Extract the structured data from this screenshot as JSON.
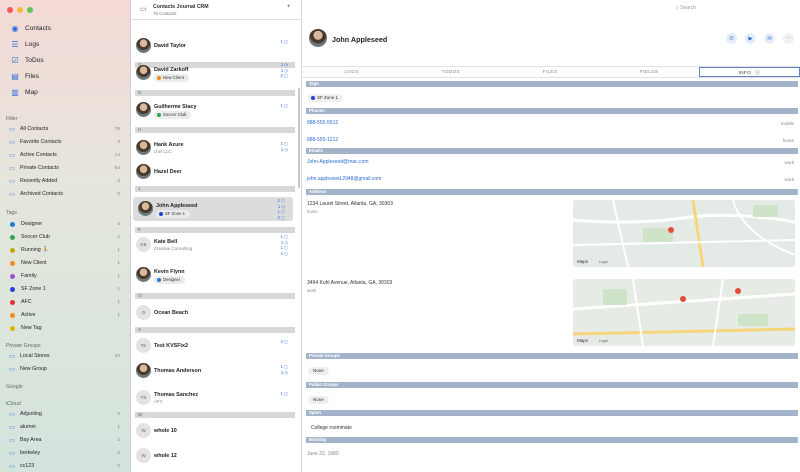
{
  "sidebar": {
    "nav": [
      {
        "label": "Contacts",
        "icon": "person-circle-icon"
      },
      {
        "label": "Logs",
        "icon": "list-icon"
      },
      {
        "label": "ToDos",
        "icon": "checklist-icon"
      },
      {
        "label": "Files",
        "icon": "document-icon"
      },
      {
        "label": "Map",
        "icon": "map-icon"
      }
    ],
    "filter_title": "Filter",
    "filters": [
      {
        "label": "All Contacts",
        "count": "76"
      },
      {
        "label": "Favorite Contacts",
        "count": "3"
      },
      {
        "label": "Active Contacts",
        "count": "14"
      },
      {
        "label": "Private Contacts",
        "count": "64"
      },
      {
        "label": "Recently Added",
        "count": "3"
      },
      {
        "label": "Archived Contacts",
        "count": "0"
      }
    ],
    "tags_title": "Tags",
    "tags": [
      {
        "label": "Designer",
        "count": "4",
        "color": "#1b7de0"
      },
      {
        "label": "Soccer Club",
        "count": "2",
        "color": "#2fa84f"
      },
      {
        "label": "Running 🏃",
        "count": "1",
        "color": "#c9a500"
      },
      {
        "label": "New Client",
        "count": "1",
        "color": "#f08a1c"
      },
      {
        "label": "Family",
        "count": "1",
        "color": "#9b4fd6"
      },
      {
        "label": "SF Zone 1",
        "count": "1",
        "color": "#2a3fd6"
      },
      {
        "label": "AFC",
        "count": "1",
        "color": "#e03131"
      },
      {
        "label": "Active",
        "count": "1",
        "color": "#f08a1c"
      },
      {
        "label": "New Tag",
        "count": "",
        "color": "#d8b400"
      }
    ],
    "private_groups_title": "Private Groups",
    "private_groups": [
      {
        "label": "Local Stores",
        "count": "52",
        "icon": "folder-icon"
      },
      {
        "label": "New Group",
        "count": "",
        "icon": "folder-icon"
      }
    ],
    "google_title": "Google",
    "icloud_title": "iCloud",
    "icloud": [
      {
        "label": "Adjunling",
        "count": "0"
      },
      {
        "label": "alumni",
        "count": "1"
      },
      {
        "label": "Bay Area",
        "count": "2"
      },
      {
        "label": "berkeley",
        "count": "0"
      },
      {
        "label": "cc123",
        "count": "0"
      }
    ]
  },
  "list": {
    "title": "Contacts Journal CRM",
    "subtitle": "76 Contacts",
    "search_placeholder": "Search",
    "sections": [
      "D",
      "G",
      "H",
      "J",
      "K",
      "O",
      "S",
      "T",
      "W"
    ],
    "items": [
      {
        "name": "David Taylor",
        "sub": "",
        "tag": "",
        "tag_color": "",
        "initials": "",
        "photo": true,
        "badges": "1 ▢"
      },
      {
        "name": "David Zarkoff",
        "sub": "",
        "tag": "New Client",
        "tag_color": "#f08a1c",
        "initials": "",
        "photo": true,
        "badges": "1 ◷\n1 ◷\n2 ▢"
      },
      {
        "name": "Guilherme Stacy",
        "sub": "",
        "tag": "Soccer Club",
        "tag_color": "#2fa84f",
        "initials": "",
        "photo": true,
        "badges": "1 ▢"
      },
      {
        "name": "Hank Azure",
        "sub": "chef LLC",
        "tag": "",
        "tag_color": "",
        "initials": "",
        "photo": true,
        "badges": "1 ▢\n1 ◷"
      },
      {
        "name": "Hazel Deer",
        "sub": "",
        "tag": "",
        "tag_color": "",
        "initials": "",
        "photo": true,
        "badges": ""
      },
      {
        "name": "John Appleseed",
        "sub": "",
        "tag": "SF Zone 1",
        "tag_color": "#2a3fd6",
        "initials": "",
        "photo": true,
        "badges": "2 ▢\n1 ◷\n1 ▢\n2 ▢"
      },
      {
        "name": "Kate Bell",
        "sub": "Creative Consulting",
        "tag": "",
        "tag_color": "",
        "initials": "KB",
        "photo": false,
        "badges": "1 ▢\n1 ◷\n1 ▢\n4 ▢"
      },
      {
        "name": "Kevin Flynn",
        "sub": "",
        "tag": "Designer",
        "tag_color": "#1b7de0",
        "initials": "",
        "photo": true,
        "badges": ""
      },
      {
        "name": "Ocean Beach",
        "sub": "",
        "tag": "",
        "tag_color": "",
        "initials": "O",
        "photo": false,
        "badges": ""
      },
      {
        "name": "Test KVSFix2",
        "sub": "",
        "tag": "",
        "tag_color": "",
        "initials": "TK",
        "photo": false,
        "badges": "4 ▢"
      },
      {
        "name": "Thomas Anderson",
        "sub": "",
        "tag": "",
        "tag_color": "",
        "initials": "",
        "photo": true,
        "badges": "1 ▢\n1 ◷"
      },
      {
        "name": "Thomas Sanchez",
        "sub": "AFC",
        "tag": "",
        "tag_color": "",
        "initials": "TS",
        "photo": false,
        "badges": "1 ▢"
      },
      {
        "name": "whole 10",
        "sub": "",
        "tag": "",
        "tag_color": "",
        "initials": "W",
        "photo": false,
        "badges": ""
      },
      {
        "name": "whole 12",
        "sub": "",
        "tag": "",
        "tag_color": "",
        "initials": "W",
        "photo": false,
        "badges": ""
      }
    ]
  },
  "detail": {
    "name": "John Appleseed",
    "actions": [
      {
        "icon": "phone-icon",
        "glyph": "✆"
      },
      {
        "icon": "video-icon",
        "glyph": "▶"
      },
      {
        "icon": "message-icon",
        "glyph": "✉"
      },
      {
        "icon": "more-icon",
        "glyph": "⋯"
      }
    ],
    "tabs": [
      "LOGS",
      "TODOS",
      "FILES",
      "FIELDS",
      "INFO"
    ],
    "active_tab": "INFO",
    "tags_title": "Tags",
    "tag": "SF Zone 1",
    "phones_title": "Phones",
    "phones": [
      {
        "value": "888-555-5512",
        "label": "mobile"
      },
      {
        "value": "888-555-1212",
        "label": "home"
      }
    ],
    "emails_title": "Emails",
    "emails": [
      {
        "value": "John-Appleseed@mac.com",
        "label": "work"
      },
      {
        "value": "john.appleseed.2048@gmail.com",
        "label": "work"
      }
    ],
    "address_title": "Address",
    "addresses": [
      {
        "value": "1234 Laurel Street, Atlanta, GA, 30303",
        "label": "home"
      },
      {
        "value": "3494 Kuhl Avenue, Atlanta, GA, 30303",
        "label": "work"
      }
    ],
    "map_brand": "Maps",
    "map_legal": "Legal",
    "private_groups_title": "Private Groups",
    "private_groups_value": "None",
    "public_groups_title": "Public Groups",
    "public_groups_value": "None",
    "spinn_title": "Spinn",
    "spinn_value": "College roommate",
    "birthday_title": "Birthday",
    "birthday_value": "June 22, 1980"
  }
}
